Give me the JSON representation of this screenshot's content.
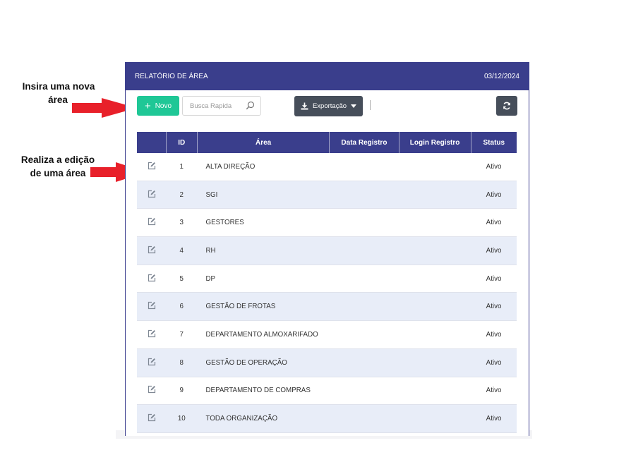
{
  "annotations": {
    "new_area_line1": "Insira uma nova",
    "new_area_line2": "área",
    "edit_area_line1": "Realiza a edição",
    "edit_area_line2": "de uma área"
  },
  "header": {
    "title": "RELATÓRIO DE ÁREA",
    "date": "03/12/2024"
  },
  "toolbar": {
    "new_label": "Novo",
    "search_placeholder": "Busca Rapida",
    "export_label": "Exportação"
  },
  "table": {
    "columns": [
      "",
      "ID",
      "Área",
      "Data Registro",
      "Login Registro",
      "Status"
    ],
    "rows": [
      {
        "id": "1",
        "area": "ALTA DIREÇÃO",
        "status": "Ativo"
      },
      {
        "id": "2",
        "area": "SGI",
        "status": "Ativo"
      },
      {
        "id": "3",
        "area": "GESTORES",
        "status": "Ativo"
      },
      {
        "id": "4",
        "area": "RH",
        "status": "Ativo"
      },
      {
        "id": "5",
        "area": "DP",
        "status": "Ativo"
      },
      {
        "id": "6",
        "area": "GESTÃO DE FROTAS",
        "status": "Ativo"
      },
      {
        "id": "7",
        "area": "DEPARTAMENTO ALMOXARIFADO",
        "status": "Ativo"
      },
      {
        "id": "8",
        "area": "GESTÃO DE OPERAÇÃO",
        "status": "Ativo"
      },
      {
        "id": "9",
        "area": "DEPARTAMENTO DE COMPRAS",
        "status": "Ativo"
      },
      {
        "id": "10",
        "area": "TODA ORGANIZAÇÃO",
        "status": "Ativo"
      }
    ]
  },
  "colors": {
    "header": "#3a3e8c",
    "new_button": "#1fc796",
    "dark_button": "#464e5a",
    "arrow": "#e8202a",
    "row_alt": "#e8edf8"
  },
  "icons": [
    "plus-icon",
    "search-icon",
    "download-icon",
    "caret-down-icon",
    "refresh-icon",
    "edit-icon",
    "arrow-icon"
  ]
}
